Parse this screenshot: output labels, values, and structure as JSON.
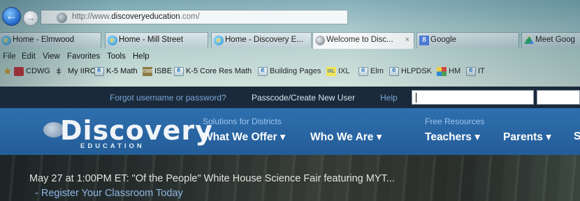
{
  "browser": {
    "url_prefix": "http://www.",
    "url_domain": "discoveryeducation",
    "url_suffix": ".com/",
    "tabs": [
      {
        "label": "Home - Elmwood",
        "icon": "ie-icon"
      },
      {
        "label": "Home - Mill Street",
        "icon": "ie-icon"
      },
      {
        "label": "Home - Discovery E...",
        "icon": "ie-icon"
      },
      {
        "label": "Welcome to Disc...",
        "icon": "globe-icon",
        "active": true,
        "close": "×"
      },
      {
        "label": "Google",
        "icon": "google-icon",
        "icon_text": "8"
      },
      {
        "label": "Meet Goog",
        "icon": "drive-icon"
      }
    ],
    "menu": [
      "File",
      "Edit",
      "View",
      "Favorites",
      "Tools",
      "Help"
    ],
    "favorites": [
      {
        "label": "CDWG",
        "icon": "red-icon"
      },
      {
        "label": "My IIRC",
        "icon": "irc-icon"
      },
      {
        "label": "K-5 Math",
        "icon": "page-icon"
      },
      {
        "label": "ISBE",
        "icon": "isbe-icon"
      },
      {
        "label": "K-5 Core Res Math",
        "icon": "page-icon"
      },
      {
        "label": "Building Pages",
        "icon": "page-icon"
      },
      {
        "label": "IXL",
        "icon": "ixl-icon"
      },
      {
        "label": "Elm",
        "icon": "page-icon"
      },
      {
        "label": "HLPDSK",
        "icon": "page-icon"
      },
      {
        "label": "HM",
        "icon": "hm-icon"
      },
      {
        "label": "IT",
        "icon": "page-icon"
      }
    ]
  },
  "site": {
    "topbar": {
      "forgot": "Forgot username or password?",
      "passcode": "Passcode/Create New User",
      "help": "Help"
    },
    "logo": {
      "main": "Discovery",
      "sub": "EDUCATION"
    },
    "sections": {
      "districts": "Solutions for Districts",
      "free": "Free Resources"
    },
    "nav": [
      "What We Offer ▾",
      "Who We Are ▾",
      "Teachers ▾",
      "Parents ▾",
      "S"
    ],
    "hero": {
      "headline": "May 27 at 1:00PM ET: \"Of the People\" White House Science Fair featuring MYT...",
      "cta": "- Register Your Classroom Today"
    }
  }
}
